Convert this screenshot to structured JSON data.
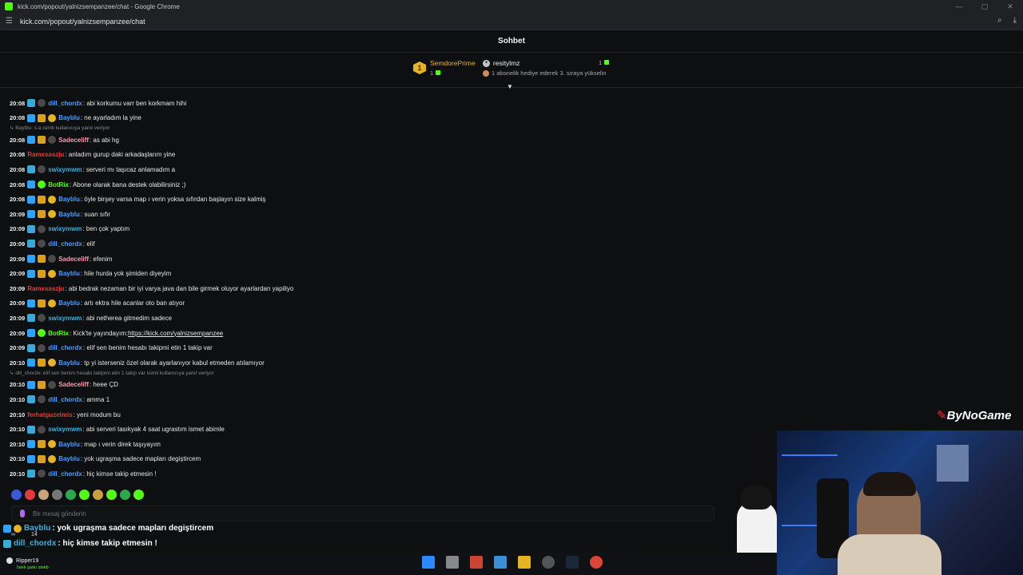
{
  "window": {
    "title": "kick.com/popout/yalnizsempanzee/chat - Google Chrome",
    "url": "kick.com/popout/yalnizsempanzee/chat",
    "controls": [
      "—",
      "▢",
      "✕"
    ]
  },
  "chat": {
    "header": "Sohbet",
    "leaderboard": {
      "first_place_rank": "1",
      "first_place_name": "SemdorePrime",
      "first_place_count": "1",
      "second_name": "resitylmz",
      "second_count": "1",
      "hint": "1 abonelik hediye ederek 3. sıraya yükselin"
    },
    "input_placeholder": "Bir mesaj gönderin"
  },
  "colors": {
    "kick_green": "#53fc18",
    "gold": "#e6b422",
    "blue_user": "#4a9dff",
    "teal_user": "#3ab0e0",
    "pink_user": "#ff9ab3",
    "red_user": "#e23a3a"
  },
  "messages": [
    {
      "time": "20:08",
      "user": "dill_chordx",
      "text": "abi korkumu varr ben korkmam hihi"
    },
    {
      "time": "20:08",
      "user": "Bayblu",
      "text": "ne ayarladım la yine"
    },
    {
      "reply": "Bayblu: s.a isimli kullanıcıya yanıt veriyor"
    },
    {
      "time": "20:08",
      "user": "Sadeceliff",
      "text": "as abi hg"
    },
    {
      "time": "20:08",
      "user": "Ramxsaszju",
      "text": "anladım gurup daki arkadaşlarım yine"
    },
    {
      "time": "20:08",
      "user": "swixymwm",
      "text": "serveri mı taşıcaz anlamadım a"
    },
    {
      "time": "20:08",
      "user": "BotRix",
      "text": "Abone olarak bana destek olabilirsiniz ;)"
    },
    {
      "time": "20:08",
      "user": "Bayblu",
      "text": "öyle birşey varsa map ı verin yoksa sıfırdan başlayın size kalmiş"
    },
    {
      "time": "20:09",
      "user": "Bayblu",
      "text": "suan sıfır"
    },
    {
      "time": "20:09",
      "user": "swixymwm",
      "text": "ben çok yaptım"
    },
    {
      "time": "20:09",
      "user": "dill_chordx",
      "text": "elif"
    },
    {
      "time": "20:09",
      "user": "Sadeceliff",
      "text": "efenim"
    },
    {
      "time": "20:09",
      "user": "Bayblu",
      "text": "hile hurda yok şimiden diyeyim"
    },
    {
      "time": "20:09",
      "user": "Ramxsaszju",
      "text": "abi bedrak nezaman bir iyi varya java dan bile girmek oluyor ayarlardan yapiliyo"
    },
    {
      "time": "20:09",
      "user": "Bayblu",
      "text": "artı ektra hile acanlar oto ban atıyor"
    },
    {
      "time": "20:09",
      "user": "swixymwm",
      "text": "abi netherea gitmedim sadece"
    },
    {
      "time": "20:09",
      "user": "BotRix",
      "text": "Kick'te yayındayım: ",
      "link": "https://kick.com/yalnizsempanzee"
    },
    {
      "time": "20:09",
      "user": "dill_chordx",
      "text": "elif sen benim hesabı takipmi etin 1 takip var"
    },
    {
      "time": "20:10",
      "user": "Bayblu",
      "text": "tp yi isterseniz özel olarak ayarlanıyor kabul etmeden atılamıyor"
    },
    {
      "reply": "dill_chordx: elif sen benim hesabı takipmi etin 1 takip var isimli kullanıcıya yanıt veriyor"
    },
    {
      "time": "20:10",
      "user": "Sadeceliff",
      "text": "heee ÇD"
    },
    {
      "time": "20:10",
      "user": "dill_chordx",
      "text": "amma 1"
    },
    {
      "time": "20:10",
      "user": "ferhatguzelmis",
      "text": "yeni modum bu"
    },
    {
      "time": "20:10",
      "user": "swixymwm",
      "text": "abi serveri tasıkyak 4 saat ugrastım ismet abimle"
    },
    {
      "time": "20:10",
      "user": "Bayblu",
      "text": "map ı verin direk taşıyayım"
    },
    {
      "time": "20:10",
      "user": "Bayblu",
      "text": "yok ugraşma sadece mapları degiştircem"
    },
    {
      "time": "20:10",
      "user": "dill_chordx",
      "text": "hiç kimse takip etmesin !"
    }
  ],
  "overlay": {
    "line1_user": "Bayblu",
    "line1_text": ": yok ugraşma sadece mapları degiştircem",
    "line2_user": "dill_chordx",
    "line2_text": ": hiç kimse takip etmesin !",
    "stat_a": "∞",
    "stat_b": "14"
  },
  "stream": {
    "logo": "ByNoGame",
    "np_user": "Ripper19",
    "np_status": "İstek şarkı stekb"
  }
}
